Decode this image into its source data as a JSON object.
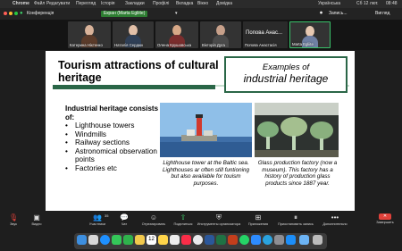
{
  "menubar": {
    "apple": "",
    "app": "Chrome",
    "items": [
      "Файл",
      "Редагувати",
      "Перегляд",
      "Історія",
      "Закладки",
      "Профілі",
      "Вкладка",
      "Вікно",
      "Довідка"
    ],
    "right": [
      "Українська",
      "Сб 12 лют.",
      "08:48"
    ]
  },
  "zoom_top": {
    "conference_label": "Конференція",
    "screen_share_label": "Екран (Marta Egliite)",
    "view_label": "Вигляд",
    "recording_label": "Запись..."
  },
  "participants": [
    {
      "name": "Катерина Ніктенко",
      "face": "#d9b39a",
      "body": "#5a3b2a"
    },
    {
      "name": "Наталія Сердюк",
      "face": "#e2c0a8",
      "body": "#2f3f56"
    },
    {
      "name": "Олена Крушовська",
      "face": "#d7a887",
      "body": "#7a2d2d"
    },
    {
      "name": "Вікторія Дуга",
      "face": "#c7a08a",
      "body": "#4a4a4a"
    },
    {
      "name": "Валентина Воврук",
      "face": "#e0b996",
      "body": "#2d4a7a"
    },
    {
      "name": "Попова Анастасія",
      "face": "",
      "body": ""
    },
    {
      "name": "Marta Egliite",
      "face": "#e7c8b1",
      "body": "#6f7fa3"
    }
  ],
  "popova_big": "Попова Анас...",
  "slide": {
    "title": "Tourism attractions of cultural heritage",
    "examples_line1": "Examples of",
    "examples_line2": "industrial heritage",
    "list_heading": "Industrial heritage consists of:",
    "list_items": [
      "Lighthouse towers",
      "Windmills",
      "Railway sections",
      "Astronomical observation points",
      "Factories etc"
    ],
    "caption1": "Lighthouse tower at the Baltic sea. Lighthouses ar often still funtioning but also available for touism purposes.",
    "caption2": "Glass production factory (now a museum). This factory has a history of production glass products since 1887 year."
  },
  "controls": {
    "audio": "Звук",
    "video": "Видео",
    "participants": "Участники",
    "participants_count": "35",
    "chat": "Чат",
    "reactions": "Отреагировать",
    "share": "Поделиться",
    "apps": "Инструменты организатора",
    "record": "Приложения",
    "pause": "Приостановить запись",
    "more": "Дополнительно",
    "leave": "Завершить"
  },
  "dock_icons": [
    {
      "name": "finder-icon",
      "color": "#3d8fe0"
    },
    {
      "name": "launchpad-icon",
      "color": "#d8d8d8"
    },
    {
      "name": "safari-icon",
      "color": "#1e90ff"
    },
    {
      "name": "messages-icon",
      "color": "#34c759"
    },
    {
      "name": "facetime-icon",
      "color": "#2fb24c"
    },
    {
      "name": "photos-icon",
      "color": "#f2c94c"
    },
    {
      "name": "calendar-icon",
      "color": "#ffffff"
    },
    {
      "name": "notes-icon",
      "color": "#ffd54a"
    },
    {
      "name": "reminders-icon",
      "color": "#ececec"
    },
    {
      "name": "music-icon",
      "color": "#fa2d48"
    },
    {
      "name": "chrome-icon",
      "color": "#e8eaed"
    },
    {
      "name": "word-icon",
      "color": "#2b579a"
    },
    {
      "name": "excel-icon",
      "color": "#1f7244"
    },
    {
      "name": "powerpoint-icon",
      "color": "#c43e1c"
    },
    {
      "name": "whatsapp-icon",
      "color": "#25d366"
    },
    {
      "name": "zoom-icon",
      "color": "#2d8cff"
    },
    {
      "name": "telegram-icon",
      "color": "#2aa3df"
    },
    {
      "name": "settings-icon",
      "color": "#8e8e93"
    },
    {
      "name": "appstore-icon",
      "color": "#1c8ef9"
    },
    {
      "name": "folder-icon",
      "color": "#6cb4f5"
    },
    {
      "name": "trash-icon",
      "color": "#bcbcbc"
    }
  ],
  "dock_calendar_day": "12",
  "colors": {
    "accent_green": "#2a6647",
    "leave_red": "#e0413a"
  }
}
